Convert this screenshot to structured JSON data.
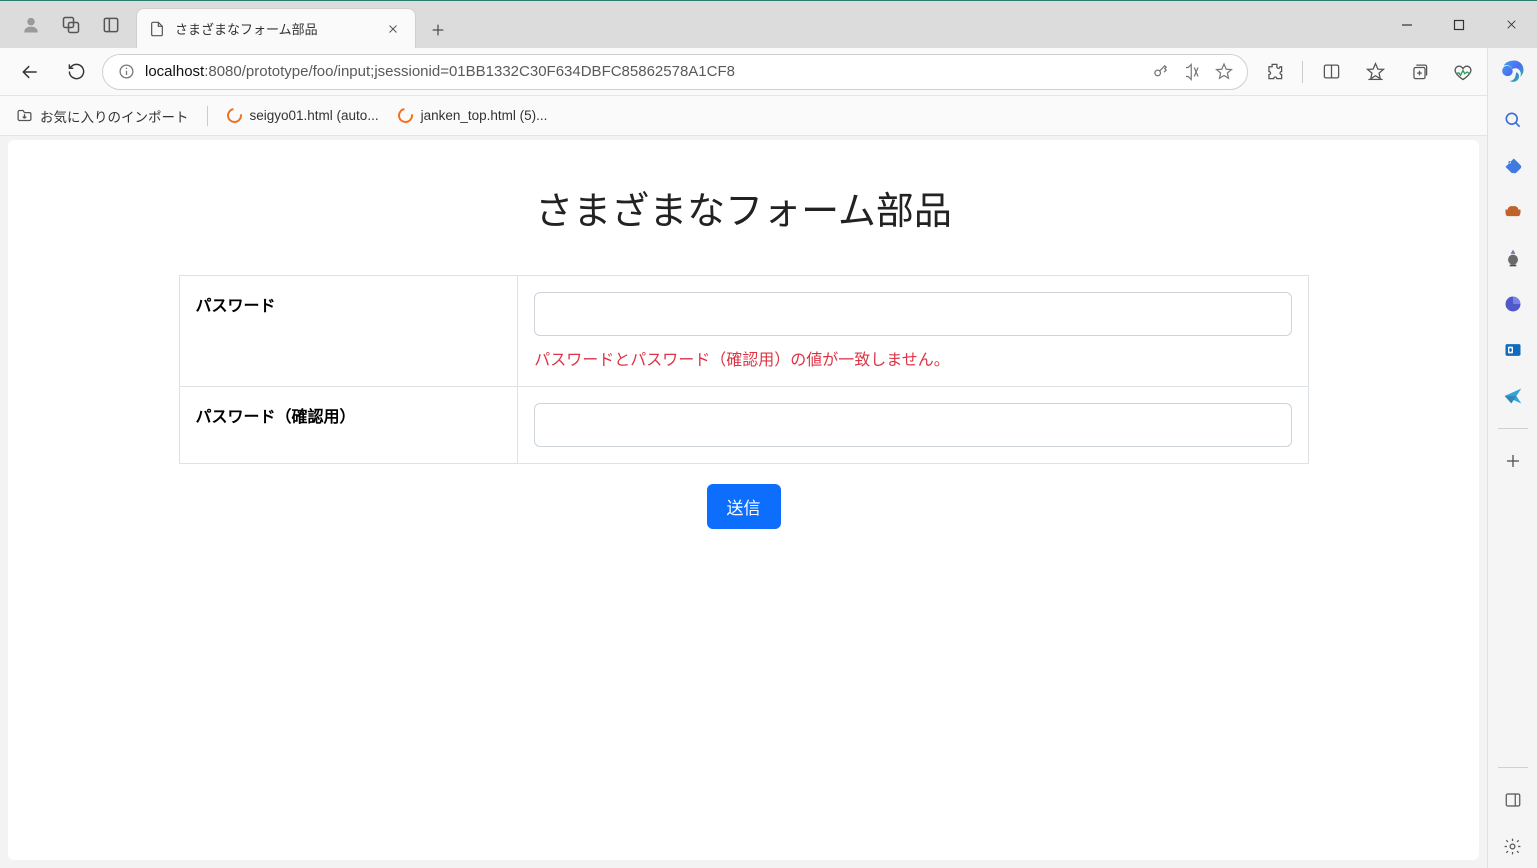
{
  "tab": {
    "title": "さまざまなフォーム部品"
  },
  "address": {
    "host": "localhost",
    "path": ":8080/prototype/foo/input;jsessionid=01BB1332C30F634DBFC85862578A1CF8"
  },
  "bookmarks": {
    "import_label": "お気に入りのインポート",
    "items": [
      {
        "label": "seigyo01.html (auto..."
      },
      {
        "label": "janken_top.html (5)..."
      }
    ]
  },
  "page": {
    "title": "さまざまなフォーム部品",
    "rows": {
      "password_label": "パスワード",
      "password_confirm_label": "パスワード（確認用）",
      "password_error": "パスワードとパスワード（確認用）の値が一致しません。"
    },
    "submit_label": "送信"
  }
}
